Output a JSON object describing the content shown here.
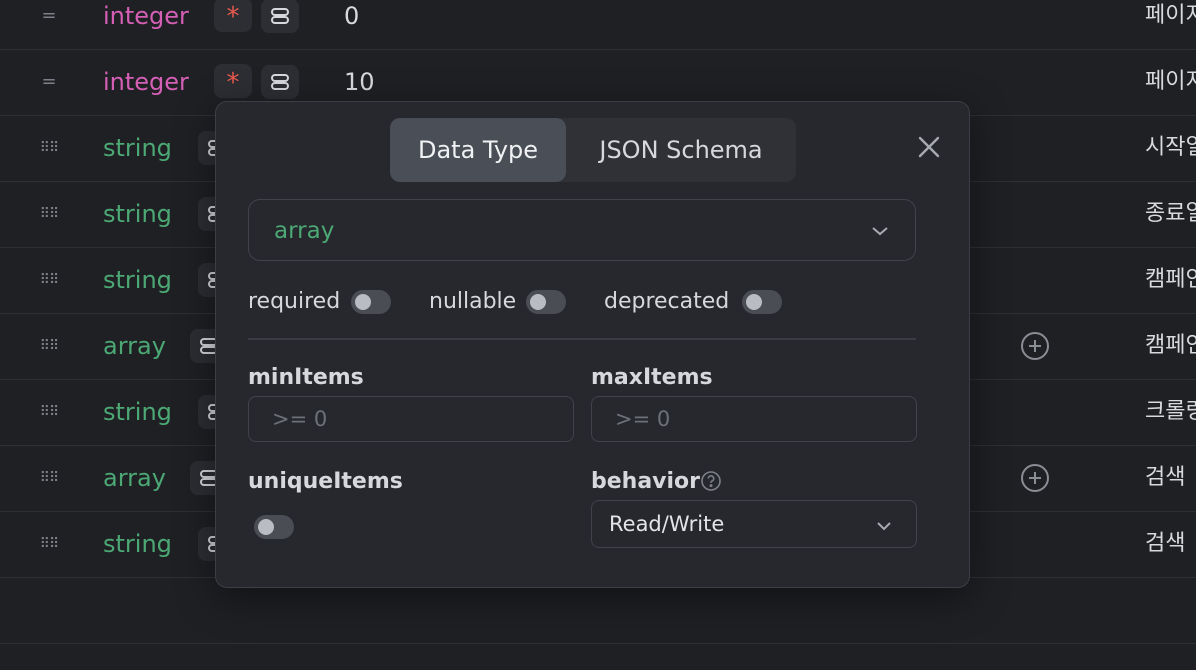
{
  "rows": [
    {
      "type": "integer",
      "required_mark": "*",
      "value": "0",
      "desc": "페이지"
    },
    {
      "type": "integer",
      "required_mark": "*",
      "value": "10",
      "desc": "페이지"
    },
    {
      "type": "string",
      "desc": "시작일"
    },
    {
      "type": "string",
      "desc": "종료일"
    },
    {
      "type": "string",
      "desc": "캠페인"
    },
    {
      "type": "array",
      "desc": "캠페인"
    },
    {
      "type": "string",
      "desc": "크롤링"
    },
    {
      "type": "array",
      "desc": "검색"
    },
    {
      "type": "string",
      "desc": "검색"
    }
  ],
  "popup": {
    "tabs": {
      "data_type": "Data Type",
      "json_schema": "JSON Schema",
      "active": "Data Type"
    },
    "type_select": {
      "value": "array"
    },
    "toggles": {
      "required": {
        "label": "required",
        "on": false
      },
      "nullable": {
        "label": "nullable",
        "on": false
      },
      "deprecated": {
        "label": "deprecated",
        "on": false
      }
    },
    "min_items": {
      "label": "minItems",
      "placeholder": ">= 0"
    },
    "max_items": {
      "label": "maxItems",
      "placeholder": ">= 0"
    },
    "unique_items": {
      "label": "uniqueItems",
      "on": false
    },
    "behavior": {
      "label": "behavior",
      "value": "Read/Write"
    }
  },
  "colors": {
    "integer": "#d45fb5",
    "string": "#4ca874",
    "required": "#ec5a4e",
    "background": "#1f2024",
    "popup": "#26282d"
  }
}
